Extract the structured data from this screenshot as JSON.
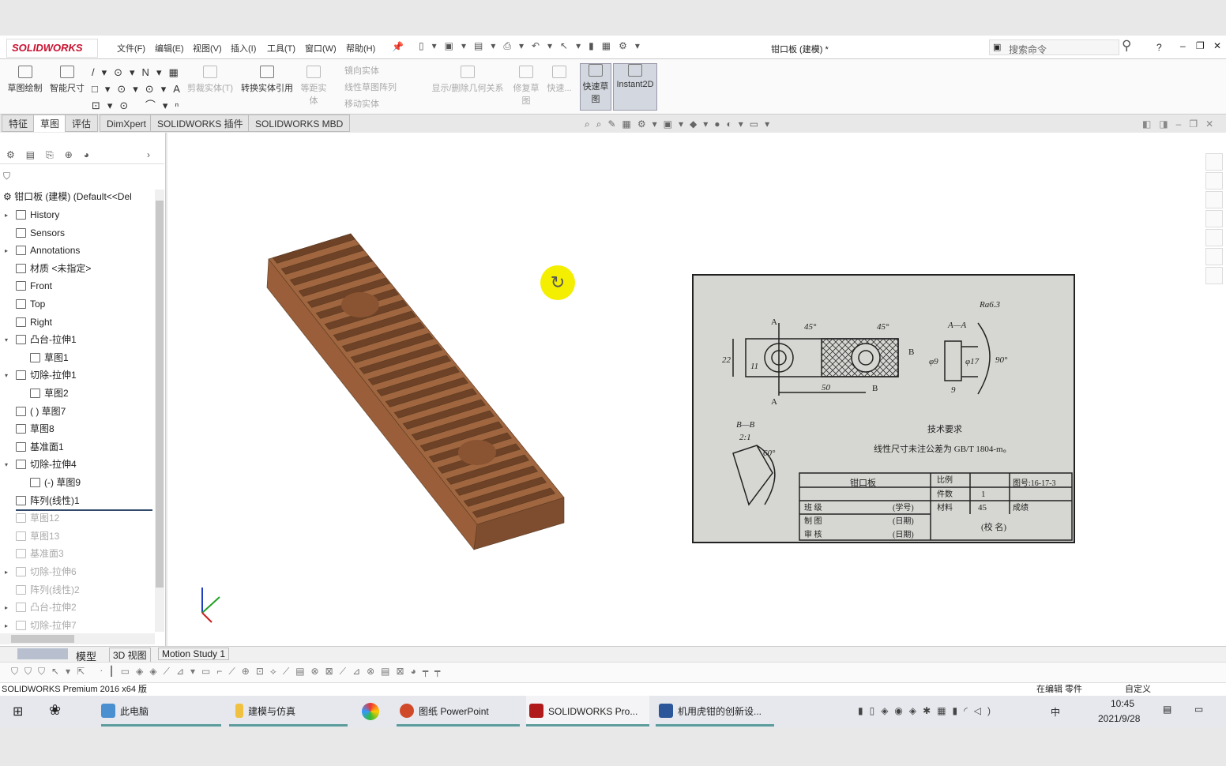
{
  "app": {
    "logo": "SOLIDWORKS",
    "title": "钳口板 (建模) *",
    "search_placeholder": "搜索命令",
    "help": "?"
  },
  "menu": [
    "文件(F)",
    "编辑(E)",
    "视图(V)",
    "插入(I)",
    "工具(T)",
    "窗口(W)",
    "帮助(H)"
  ],
  "ribbon": [
    {
      "label": "草图绘制",
      "enabled": true
    },
    {
      "label": "智能尺寸",
      "enabled": true
    },
    {
      "label": "剪裁实体(T)",
      "enabled": false
    },
    {
      "label": "转换实体引用",
      "enabled": true
    },
    {
      "label": "等距实体",
      "enabled": false
    },
    {
      "label": "镜向实体",
      "enabled": false
    },
    {
      "label": "线性草图阵列",
      "enabled": false
    },
    {
      "label": "移动实体",
      "enabled": false
    },
    {
      "label": "显示/删除几何关系",
      "enabled": false
    },
    {
      "label": "修复草图",
      "enabled": false
    },
    {
      "label": "快速...",
      "enabled": false
    },
    {
      "label": "快速草图",
      "enabled": true,
      "active": true
    },
    {
      "label": "Instant2D",
      "enabled": true,
      "active": true
    }
  ],
  "tabs": [
    "特征",
    "草图",
    "评估",
    "DimXpert",
    "SOLIDWORKS 插件",
    "SOLIDWORKS MBD"
  ],
  "active_tab": "草图",
  "tree": {
    "root": "钳口板 (建模)  (Default<<Del",
    "items": [
      {
        "label": "History",
        "expand": true,
        "dim": false,
        "indent": 0
      },
      {
        "label": "Sensors",
        "expand": false,
        "dim": false,
        "indent": 0
      },
      {
        "label": "Annotations",
        "expand": true,
        "dim": false,
        "indent": 0
      },
      {
        "label": "材质 <未指定>",
        "expand": false,
        "dim": false,
        "indent": 0
      },
      {
        "label": "Front",
        "expand": false,
        "dim": false,
        "indent": 0
      },
      {
        "label": "Top",
        "expand": false,
        "dim": false,
        "indent": 0
      },
      {
        "label": "Right",
        "expand": false,
        "dim": false,
        "indent": 0
      },
      {
        "label": "凸台-拉伸1",
        "expand": "open",
        "dim": false,
        "indent": 0
      },
      {
        "label": "草图1",
        "expand": false,
        "dim": false,
        "indent": 1
      },
      {
        "label": "切除-拉伸1",
        "expand": "open",
        "dim": false,
        "indent": 0
      },
      {
        "label": "草图2",
        "expand": false,
        "dim": false,
        "indent": 1
      },
      {
        "label": "( ) 草图7",
        "expand": false,
        "dim": false,
        "indent": 0
      },
      {
        "label": "草图8",
        "expand": false,
        "dim": false,
        "indent": 0
      },
      {
        "label": "基准面1",
        "expand": false,
        "dim": false,
        "indent": 0
      },
      {
        "label": "切除-拉伸4",
        "expand": "open",
        "dim": false,
        "indent": 0
      },
      {
        "label": "(-) 草图9",
        "expand": false,
        "dim": false,
        "indent": 1
      },
      {
        "label": "阵列(线性)1",
        "expand": false,
        "dim": false,
        "indent": 0
      },
      {
        "label": "草图12",
        "expand": false,
        "dim": true,
        "indent": 0
      },
      {
        "label": "草图13",
        "expand": false,
        "dim": true,
        "indent": 0
      },
      {
        "label": "基准面3",
        "expand": false,
        "dim": true,
        "indent": 0
      },
      {
        "label": "切除-拉伸6",
        "expand": true,
        "dim": true,
        "indent": 0
      },
      {
        "label": "阵列(线性)2",
        "expand": false,
        "dim": true,
        "indent": 0
      },
      {
        "label": "凸台-拉伸2",
        "expand": true,
        "dim": true,
        "indent": 0
      },
      {
        "label": "切除-拉伸7",
        "expand": true,
        "dim": true,
        "indent": 0
      }
    ]
  },
  "drawing": {
    "roughness": "Ra6.3",
    "section_aa": "A—A",
    "section_bb": "B—B",
    "scale_bb": "2:1",
    "dims": [
      "22",
      "11",
      "50",
      "45°",
      "45°",
      "φ9",
      "φ17",
      "90°",
      "9",
      "60°",
      "A",
      "A",
      "B",
      "B"
    ],
    "tech_title": "技术要求",
    "tech_note": "线性尺寸未注公差为 GB/T 1804-m。",
    "title_block": {
      "part": "钳口板",
      "scale_label": "比例",
      "qty_label": "件数",
      "qty": "1",
      "material_label": "材料",
      "material": "45",
      "drawing_no": "图号:16-17-3",
      "grade_label": "成绩",
      "class": "班 级",
      "drawn": "制 图",
      "checked": "审 核",
      "student_no": "(学号)",
      "date1": "(日期)",
      "date2": "(日期)",
      "school": "(校 名)"
    }
  },
  "model_color": "#a0663f",
  "bottom_tabs": [
    "模型",
    "3D 视图",
    "Motion Study 1"
  ],
  "status": {
    "product": "SOLIDWORKS Premium 2016 x64 版",
    "mode": "在编辑 零件",
    "custom": "自定义"
  },
  "taskbar": {
    "items": [
      "此电脑",
      "建模与仿真",
      "图纸 PowerPoint",
      "SOLIDWORKS Pro...",
      "机用虎钳的创新设..."
    ],
    "time": "10:45",
    "date": "2021/9/28",
    "ime": "中"
  }
}
